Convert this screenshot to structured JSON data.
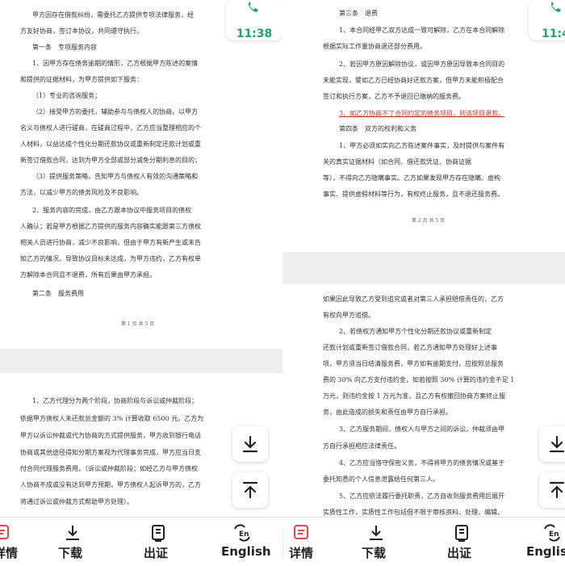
{
  "left_pane": {
    "page_top_lines": [
      "甲方因存在借款纠纷，需委托乙方提供专项法律服务，经",
      "方友好协商，签订本协议，共同遵守执行。",
      "第一条　专项服务内容",
      "1、因甲方存在债务逾期的情形，乙方根据甲方陈述的案情",
      "和提供的证据材料，为甲方提供如下服务：",
      "（1）专业的咨询服务；",
      "（2）接受甲方的委托，辅助参与与债权人的协商。以甲方",
      "名义与债权人进行磋商，在磋商过程中，乙方应当整理相应的个",
      "人材料，以益达成个性化分期还款协议或重新制定还款计划或重",
      "新签订借款合同，达到为甲方全部或部分减免分期利息的目的；",
      "（3）提供服务策略，告知甲方与债权人有效的沟通策略和",
      "方法，以减少甲方的债务风险及不良影响。",
      "2、服务内容的完成，由乙方跟本协议中服务项目的债权",
      "人确认；若是甲方根据乙方提供的服务内容确实能跟第三方债权",
      "相关人员进行协商，减少不良影响，但由于甲方有新产生或未告",
      "知乙方的情况，导致协议目标未达成，为甲方违约，乙方有权单",
      "方解除本合同且不退费，所有后果由甲方承担。",
      "第二条　服务费用"
    ],
    "page_top_footer": "第 1 页 共 5 页",
    "page_bottom_lines": [
      "1、乙方代理分为两个阶段，协商阶段与诉讼或仲裁阶段；",
      "依据甲方债权人未还款总金额的 3% 计算收取 6500 元。乙方为",
      "甲方以诉讼仲裁或代为协商的方式提供服务，甲方收到银行电话",
      "协商或其他途径得知分期方案视为代理事务完成，甲方应当日支",
      "付合同代理服务费用。（诉讼或仲裁阶段；如经乙方与甲方债权",
      "人协商不成或没有达到甲方预期，甲方债权人起诉甲方的，乙方",
      "将通过诉讼或仲裁方式帮助甲方处理）。"
    ],
    "timer": "11:38"
  },
  "right_pane": {
    "page_top_lines": [
      "第三条　退费",
      "1、本合同经甲乙双方达成一致可解除，乙方在本合同解除",
      "根据实际工作量协商退还部分费用。",
      "2、若因甲方原因解除协议，或因甲方原因导致本合同目的",
      "未能实现，譬如乙方已经协商好还款方案，但甲方未能积极配合",
      "签订和执行方案，乙方不予退回已缴纳的服务费。",
      "3、如乙方协商不了合同约定的债务项目，则该项目退款。",
      "第四条　双方的权利和义务",
      "1、甲方必须如实向乙方陈述案件事实，及时提供与案件有",
      "关的真实证据材料（如合同、借还款凭证、协商证据",
      "等），不得向乙方隐瞒事实。乙方如果发现甲方存在隐瞒、虚构",
      "事实、提供虚假材料等行为，有权终止服务，且不退还服务费。"
    ],
    "page_top_footer": "第 2 页 共 5 页",
    "page_bottom_lines": [
      "如果因此导致乙方受到追究或者对第三人承担赔偿责任的，乙方",
      "有权向甲方追偿。",
      "2、若债权方通知甲方个性化分期还款协议或重新制定",
      "还款计划或重新签订借款合同，若乙方通知甲方处理好上述事",
      "项，甲方须当日结清服务费，甲方如有逾期支付，应按照总服务",
      "费的 30% 向乙方支付违约金，如若按照 30% 计算的违约金不足 1",
      "万元，则违约金按 1 万元为准，且乙方有权撤回协商方案终止服",
      "务，由此造成的损失和责任由甲方自行承担。",
      "3、乙方服务期间，债权人与甲方之间的诉讼，仲裁须由甲",
      "方自行承担相应法律责任。",
      "4、乙方应当恪守保密义务，不得将甲方的债务情况或基于",
      "委托知悉的个人信息泄露给任何第三人。",
      "5、乙方应依法履行委托职责，乙方自收到服务费用后展开",
      "实质性工作，实质性工作包括但不限于审核资料、处理、编辑、"
    ],
    "timer": "11:4"
  },
  "bottom_bar": {
    "items": [
      {
        "label": "详情",
        "icon": "details-icon"
      },
      {
        "label": "下载",
        "icon": "download-icon"
      },
      {
        "label": "出证",
        "icon": "certificate-icon"
      },
      {
        "label": "English",
        "icon": "translate-icon"
      }
    ]
  },
  "floating_buttons": [
    "scroll-to-bottom-icon",
    "scroll-to-top-icon"
  ],
  "colors": {
    "accent_green": "#1aa86b",
    "details_red": "#e8454a",
    "highlight_red": "#c0392b"
  }
}
